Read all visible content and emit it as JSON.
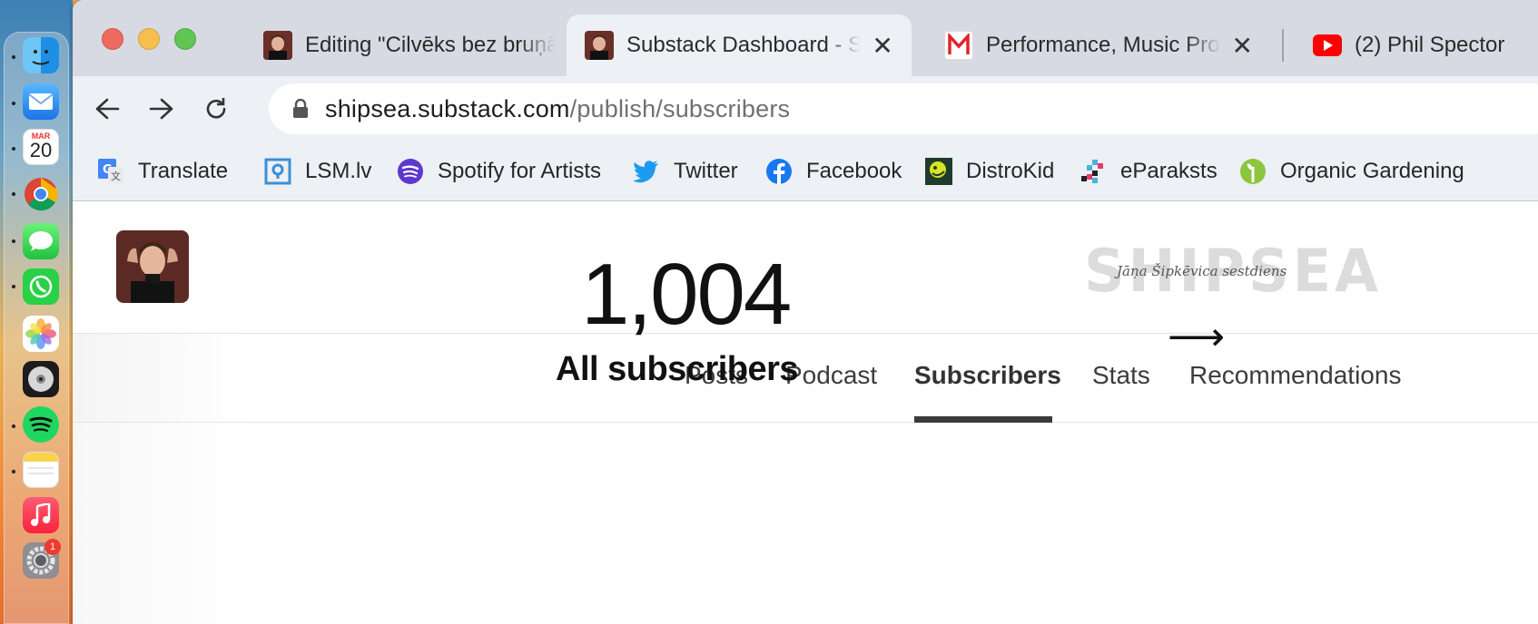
{
  "dock": {
    "calendar_month": "MAR",
    "calendar_day": "20",
    "settings_badge": "1"
  },
  "browser": {
    "tabs": [
      {
        "title": "Editing \"Cilvēks bez bruņām\"",
        "favicon": "portrait-favicon"
      },
      {
        "title": "Substack Dashboard - Shipsea",
        "favicon": "portrait-favicon",
        "active": true
      },
      {
        "title": "Performance, Music Production",
        "favicon": "m-logo-favicon"
      },
      {
        "title": "(2) Phil Spector",
        "favicon": "youtube-favicon"
      }
    ],
    "url": {
      "host": "shipsea.substack.com",
      "path": "/publish/subscribers"
    },
    "bookmarks": [
      {
        "label": "Translate",
        "icon": "google-translate-icon"
      },
      {
        "label": "LSM.lv",
        "icon": "lsm-icon"
      },
      {
        "label": "Spotify for Artists",
        "icon": "spotify-icon"
      },
      {
        "label": "Twitter",
        "icon": "twitter-icon"
      },
      {
        "label": "Facebook",
        "icon": "facebook-icon"
      },
      {
        "label": "DistroKid",
        "icon": "distrokid-icon"
      },
      {
        "label": "eParaksts",
        "icon": "eparaksts-icon"
      },
      {
        "label": "Organic Gardening",
        "icon": "gardening-icon"
      }
    ]
  },
  "page": {
    "logo_text": "SHIPSEA",
    "logo_script": "Jāņa Šipkēvica sestdiens",
    "nav": [
      {
        "label": "Posts"
      },
      {
        "label": "Podcast"
      },
      {
        "label": "Subscribers",
        "active": true
      },
      {
        "label": "Stats"
      },
      {
        "label": "Recommendations"
      }
    ],
    "subscribers": {
      "count": "1,004",
      "label": "All subscribers",
      "arrow": "⟶"
    }
  },
  "colors": {
    "tab_bar": "#d8dae3",
    "toolbar": "#edf0f5",
    "active_underline": "#3a3a3a",
    "close_red": "#ed6a5e",
    "minimize_yellow": "#f5bf4f",
    "zoom_green": "#61c554"
  }
}
